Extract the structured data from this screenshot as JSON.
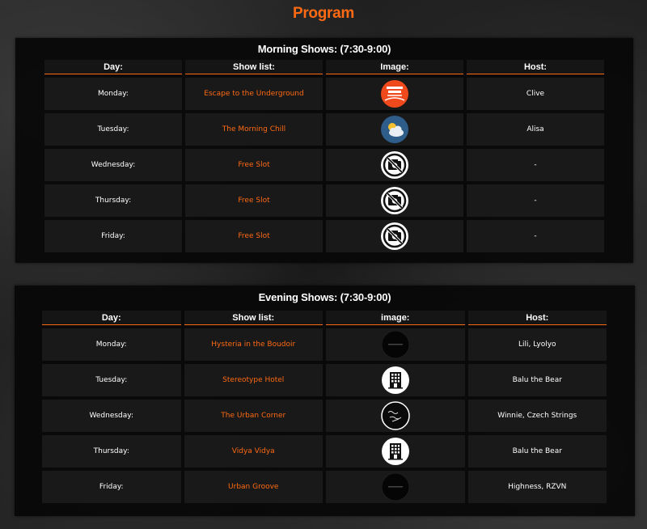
{
  "page_title": "Program",
  "morning": {
    "title": "Morning Shows: (7:30-9:00)",
    "headers": [
      "Day:",
      "Show list:",
      "Image:",
      "Host:"
    ],
    "rows": [
      {
        "day": "Monday:",
        "show": "Escape to the Underground",
        "image": "escape-to-the-underground-logo",
        "host": "Clive"
      },
      {
        "day": "Tuesday:",
        "show": "The Morning Chill",
        "image": "weather-sun-cloud-icon",
        "host": "Alisa"
      },
      {
        "day": "Wednesday:",
        "show": "Free Slot",
        "image": "no-photo-icon",
        "host": "-"
      },
      {
        "day": "Thursday:",
        "show": "Free Slot",
        "image": "no-photo-icon",
        "host": "-"
      },
      {
        "day": "Friday:",
        "show": "Free Slot",
        "image": "no-photo-icon",
        "host": "-"
      }
    ]
  },
  "evening": {
    "title": "Evening Shows: (7:30-9:00)",
    "headers": [
      "Day:",
      "Show list:",
      "image:",
      "Host:"
    ],
    "rows": [
      {
        "day": "Monday:",
        "show": "Hysteria in the Boudoir",
        "image": "dark-show-logo",
        "host": "Lili, Lyolyo"
      },
      {
        "day": "Tuesday:",
        "show": "Stereotype Hotel",
        "image": "hotel-building-icon",
        "host": "Balu the Bear"
      },
      {
        "day": "Wednesday:",
        "show": "The Urban Corner",
        "image": "urban-corner-logo",
        "host": "Winnie, Czech Strings"
      },
      {
        "day": "Thursday:",
        "show": "Vidya Vidya",
        "image": "hotel-building-icon",
        "host": "Balu the Bear"
      },
      {
        "day": "Friday:",
        "show": "Urban Groove",
        "image": "dark-show-logo",
        "host": "Highness, RZVN"
      }
    ]
  },
  "colors": {
    "accent": "#ff6a13",
    "panel": "#080808",
    "cell": "#191919"
  }
}
